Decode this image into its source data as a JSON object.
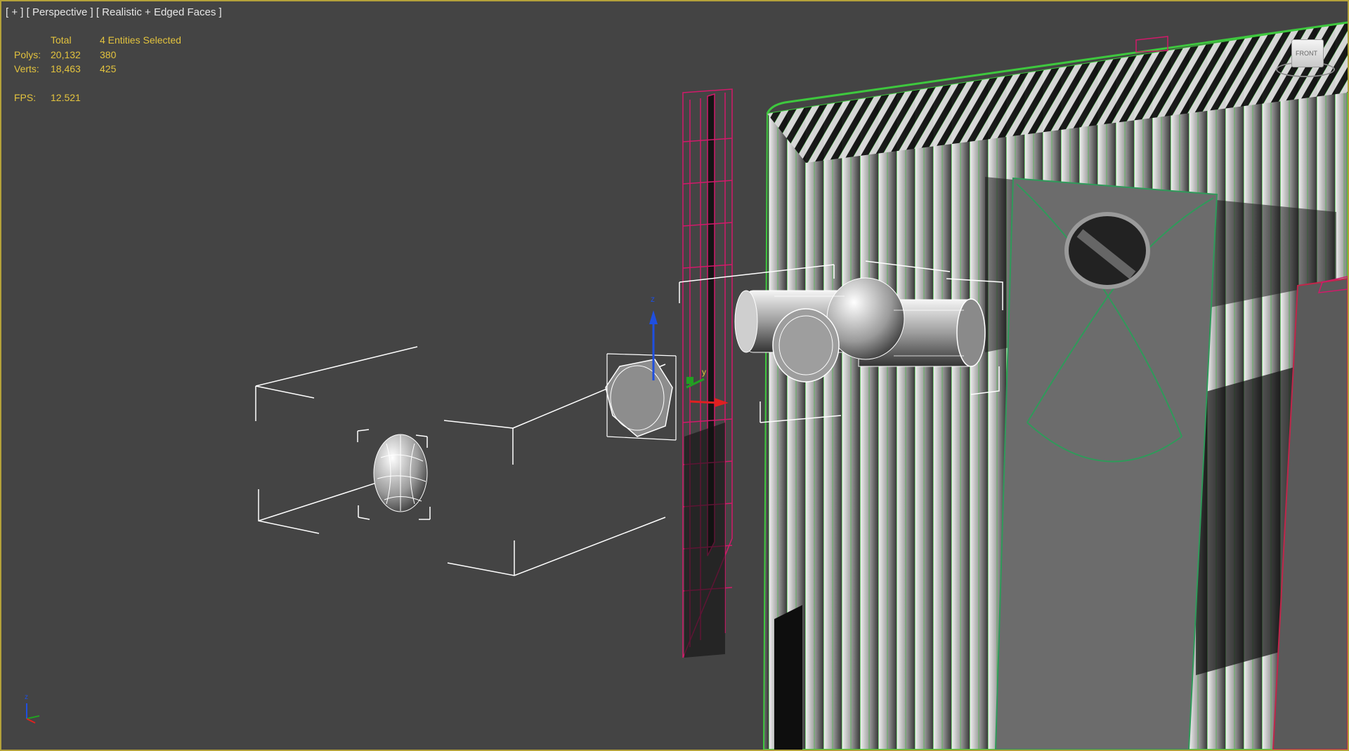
{
  "viewport": {
    "label_parts": [
      "[ + ]",
      "[ Perspective ]",
      "[ Realistic + Edged Faces ]"
    ]
  },
  "stats": {
    "header_total": "Total",
    "header_selected": "4 Entities Selected",
    "rows": [
      {
        "label": "Polys:",
        "total": "20,132",
        "selected": "380"
      },
      {
        "label": "Verts:",
        "total": "18,463",
        "selected": "425"
      }
    ],
    "fps_label": "FPS:",
    "fps_value": "12.521"
  },
  "viewcube": {
    "face_text": "FRONT"
  },
  "axis_labels": {
    "z": "z",
    "y": "y",
    "x": "x"
  },
  "colors": {
    "viewport_bg": "#444444",
    "active_border": "#b3a13a",
    "stats_text": "#e3c33e",
    "wire_selected": "#ffffff",
    "wire_green": "#3ec83e",
    "wire_magenta": "#d11a6a",
    "axis_z": "#1f4fe0",
    "axis_y": "#22a022",
    "axis_x": "#e02020"
  }
}
